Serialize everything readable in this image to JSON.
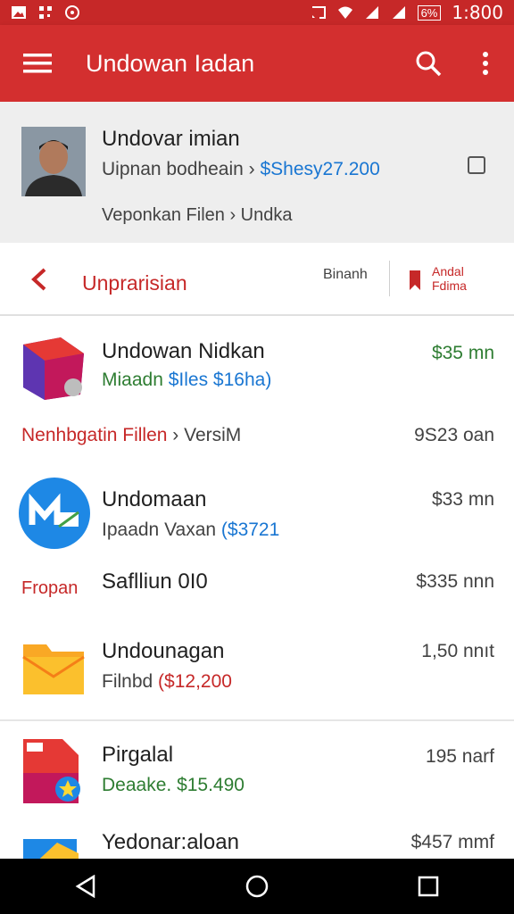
{
  "status_bar": {
    "time": "1:800",
    "battery": "6%"
  },
  "app_bar": {
    "title": "Undowan Iadan"
  },
  "profile": {
    "name": "Undovar imian",
    "subtitle_prefix": "Uipnan bodheain ›",
    "subtitle_amount": "$Shesy27.200",
    "meta": "Veponkan Filen › Undka"
  },
  "toolbar": {
    "label": "Unprarisian",
    "button1": "Binanh",
    "button2": "Andal Fdima"
  },
  "items": [
    {
      "title": "Undowan Nidkan",
      "sub_prefix": "Miaadn",
      "sub_amount": "$Iles $16ha)",
      "value": "$35 mn",
      "icon": "red-purple-package-icon"
    },
    {
      "title": "Nenhbgatin Fillen",
      "title_suffix": "› VersiM",
      "value": "9S23 oan"
    },
    {
      "title": "Undomaan",
      "sub_prefix": "Ipaadn Vaxan",
      "sub_amount": "($3721",
      "value": "$33 mn",
      "icon": "blue-mail-icon"
    },
    {
      "left_label": "Fropan",
      "title": "Saflliun 0I0",
      "value": "$335 nnn"
    },
    {
      "title": "Undounagan",
      "sub_prefix": "Filnbd",
      "sub_amount": "($12,200",
      "value": "1,50 nnıt",
      "icon": "yellow-folder-icon"
    },
    {
      "title": "Pirgalal",
      "sub_prefix": "Deaake.",
      "sub_amount": "$15.490",
      "value": "195 narf",
      "icon": "red-document-star-icon"
    },
    {
      "title": "Yedonar:aloan",
      "value": "$457 mmf",
      "icon": "colorful-doc-icon"
    }
  ]
}
